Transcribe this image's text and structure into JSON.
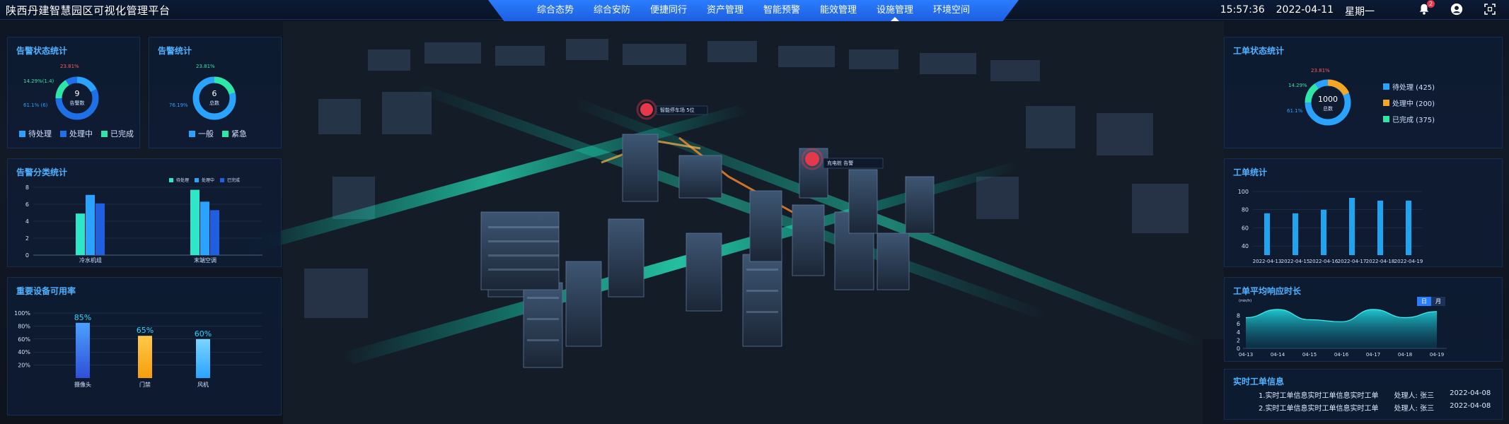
{
  "header": {
    "title": "陕西丹建智慧园区可视化管理平台",
    "nav": [
      {
        "label": "综合态势",
        "active": false
      },
      {
        "label": "综合安防",
        "active": false
      },
      {
        "label": "便捷同行",
        "active": false
      },
      {
        "label": "资产管理",
        "active": false
      },
      {
        "label": "智能预警",
        "active": false
      },
      {
        "label": "能效管理",
        "active": false
      },
      {
        "label": "设施管理",
        "active": true
      },
      {
        "label": "环境空间",
        "active": false
      }
    ],
    "time": "15:57:36",
    "date": "2022-04-11",
    "weekday": "星期一",
    "notification_count": "2",
    "icons": {
      "bell": "bell-icon",
      "user": "user-icon",
      "fullscreen": "fullscreen-icon"
    }
  },
  "alarm_status": {
    "title": "告警状态统计",
    "center_value": "9",
    "center_label": "告警数",
    "pct_top": "23.81%",
    "pct_mid": "14.29%(1.4)",
    "pct_bottom": "61.1% (6)",
    "legend": [
      "待处理",
      "处理中",
      "已完成"
    ],
    "colors": [
      "#2aa3ff",
      "#1f6fe6",
      "#2ee6a6"
    ]
  },
  "alarm_stats": {
    "title": "告警统计",
    "center_value": "6",
    "center_label": "总数",
    "pct_top": "23.81%",
    "pct_left": "76.19%",
    "legend": [
      "一般",
      "紧急"
    ],
    "colors": [
      "#2aa3ff",
      "#2ee6a6"
    ]
  },
  "alarm_category": {
    "title": "告警分类统计",
    "legend": [
      "待处理",
      "处理中",
      "已完成"
    ],
    "colors": [
      "#2ee6c8",
      "#2aa3ff",
      "#1f5fe0"
    ]
  },
  "availability": {
    "title": "重要设备可用率"
  },
  "workorder_status": {
    "title": "工单状态统计",
    "center_value": "1000",
    "center_label": "总数",
    "pct_top": "23.81%",
    "pct_mid": "14.29%",
    "pct_left": "61.1%",
    "legend": [
      "待处理 (425)",
      "处理中 (200)",
      "已完成 (375)"
    ],
    "colors": [
      "#2aa3ff",
      "#f5a623",
      "#2ee6a6"
    ]
  },
  "workorder_stats": {
    "title": "工单统计"
  },
  "response_time": {
    "title": "工单平均响应时长",
    "unit": "(min/h)",
    "toggle": [
      "日",
      "月"
    ]
  },
  "realtime": {
    "title": "实时工单信息",
    "rows": [
      {
        "text": "1.实时工单信息实时工单信息实时工单",
        "handler": "处理人: 张三",
        "date": "2022-04-08"
      },
      {
        "text": "2.实时工单信息实时工单信息实时工单",
        "handler": "处理人: 张三",
        "date": "2022-04-08"
      }
    ]
  },
  "map_markers": [
    {
      "label": "智能停车场 5位"
    },
    {
      "label": "充电桩 告警"
    }
  ],
  "chart_data": [
    {
      "type": "bar",
      "title": "告警分类统计",
      "categories": [
        "冷水机组",
        "末端空调"
      ],
      "series": [
        {
          "name": "待处理",
          "values": [
            4.9,
            7.7
          ]
        },
        {
          "name": "处理中",
          "values": [
            7.1,
            6.3
          ]
        },
        {
          "name": "已完成",
          "values": [
            6.1,
            5.3
          ]
        }
      ],
      "ylim": [
        0,
        8
      ],
      "yticks": [
        0,
        2,
        4,
        6,
        8
      ]
    },
    {
      "type": "bar",
      "title": "重要设备可用率",
      "categories": [
        "摄像头",
        "门禁",
        "风机"
      ],
      "values": [
        85,
        65,
        60
      ],
      "labels": [
        "85%",
        "65%",
        "60%"
      ],
      "yticks": [
        "20%",
        "40%",
        "60%",
        "80%",
        "100%"
      ],
      "ylim": [
        0,
        100
      ]
    },
    {
      "type": "bar",
      "title": "工单统计",
      "categories": [
        "2022-04-13",
        "2022-04-15",
        "2022-04-16",
        "2022-04-17",
        "2022-04-18",
        "2022-04-19"
      ],
      "values": [
        76,
        76,
        80,
        93,
        90,
        90
      ],
      "yticks": [
        40,
        60,
        80,
        100
      ],
      "ylim": [
        30,
        100
      ]
    },
    {
      "type": "area",
      "title": "工单平均响应时长",
      "categories": [
        "04-13",
        "04-14",
        "04-15",
        "04-16",
        "04-17",
        "04-18",
        "04-19"
      ],
      "values": [
        7.5,
        9.5,
        7.0,
        6.5,
        9.5,
        7.5,
        9.0
      ],
      "yticks": [
        0,
        2,
        4,
        6,
        8
      ],
      "ylim": [
        0,
        10
      ]
    }
  ]
}
